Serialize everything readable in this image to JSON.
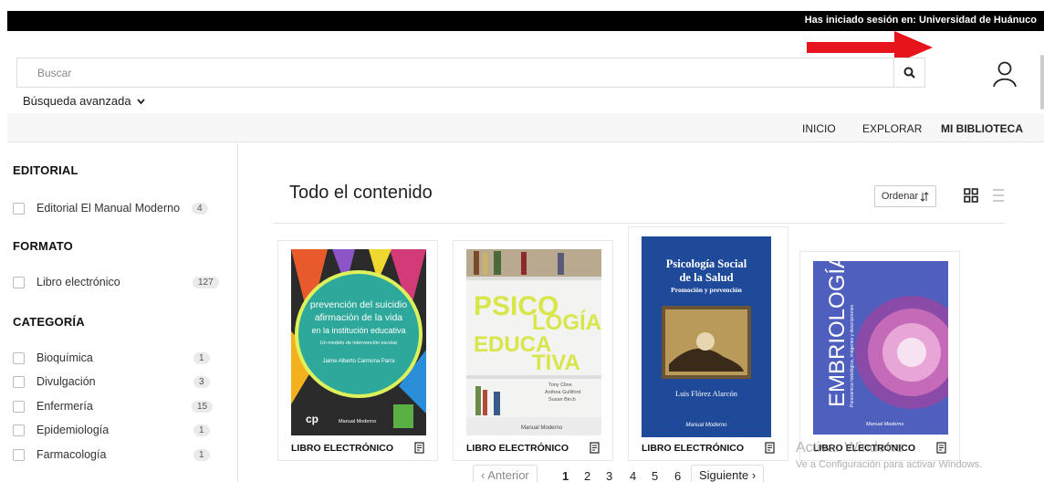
{
  "session": {
    "text": "Has iniciado sesión en: Universidad de Huánuco"
  },
  "search": {
    "placeholder": "Buscar",
    "advanced_label": "Búsqueda avanzada"
  },
  "nav": {
    "items": [
      "INICIO",
      "EXPLORAR",
      "MI BIBLIOTECA"
    ],
    "active": "MI BIBLIOTECA"
  },
  "facets": {
    "editorial": {
      "title": "EDITORIAL",
      "items": [
        {
          "label": "Editorial El Manual Moderno",
          "count": "4"
        }
      ]
    },
    "formato": {
      "title": "FORMATO",
      "items": [
        {
          "label": "Libro electrónico",
          "count": "127"
        }
      ]
    },
    "categoria": {
      "title": "CATEGORÍA",
      "items": [
        {
          "label": "Bioquímica",
          "count": "1"
        },
        {
          "label": "Divulgación",
          "count": "3"
        },
        {
          "label": "Enfermería",
          "count": "15"
        },
        {
          "label": "Epidemiología",
          "count": "1"
        },
        {
          "label": "Farmacología",
          "count": "1"
        }
      ]
    }
  },
  "main": {
    "title": "Todo el contenido",
    "sort_label": "Ordenar",
    "books": [
      {
        "type": "LIBRO ELECTRÓNICO",
        "cover_lines": [
          "prevención del suicidio",
          "afirmación de la vida",
          "en la institución educativa"
        ],
        "cover_subtitle": "Un modelo de intervención escolar",
        "cover_author": "Jaime Alberto Carmona Parra",
        "cover_publisher": "Manual Moderno"
      },
      {
        "type": "LIBRO ELECTRÓNICO",
        "cover_lines": [
          "PSICO",
          "LOGÍA",
          "EDUCA",
          "TIVA"
        ],
        "cover_author": "Tony Cline\nAnthea Gulliford\nSusan Birch",
        "cover_publisher": "Manual Moderno"
      },
      {
        "type": "LIBRO ELECTRÓNICO",
        "cover_title": "Psicología Social de la Salud",
        "cover_subtitle": "Promoción y prevención",
        "cover_author": "Luis Flórez Alarcón",
        "cover_publisher": "Manual Moderno"
      },
      {
        "type": "LIBRO ELECTRÓNICO",
        "cover_title": "EMBRIOLOGÍA",
        "cover_subtitle": "Panorámica histológica, imágenes y descripciones",
        "cover_publisher": "Manual Moderno"
      }
    ]
  },
  "pagination": {
    "prev": "Anterior",
    "pages": [
      "1",
      "2",
      "3",
      "4",
      "5",
      "6"
    ],
    "next": "Siguiente"
  },
  "watermark": {
    "line1": "Activar Windows",
    "line2": "Ve a Configuración para activar Windows."
  },
  "colors": {
    "arrow": "#e8141b",
    "topbar": "#000000",
    "book3_bg": "#1f4a99",
    "book4_bg": "#4f5fbe"
  }
}
